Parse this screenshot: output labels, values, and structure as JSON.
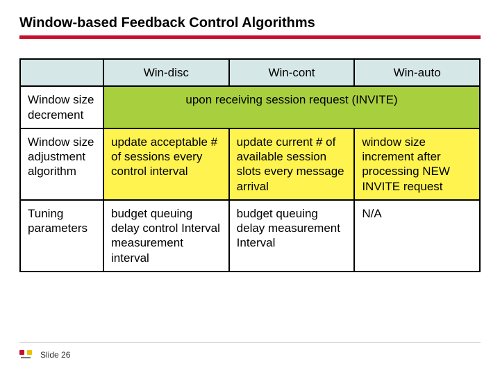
{
  "title": "Window-based Feedback Control Algorithms",
  "columns": {
    "c1": "Win-disc",
    "c2": "Win-cont",
    "c3": "Win-auto"
  },
  "rows": {
    "r1": {
      "label": "Window size decrement",
      "merged": "upon receiving session request (INVITE)"
    },
    "r2": {
      "label": "Window size adjustment algorithm",
      "c1": "update acceptable # of sessions every control interval",
      "c2": "update current # of available session slots every message arrival",
      "c3": "window size increment after processing NEW INVITE request"
    },
    "r3": {
      "label": "Tuning parameters",
      "c1": "budget queuing delay control Interval measurement interval",
      "c2": "budget queuing delay measurement Interval",
      "c3": "N/A"
    }
  },
  "footer": {
    "slide_label": "Slide 26"
  }
}
